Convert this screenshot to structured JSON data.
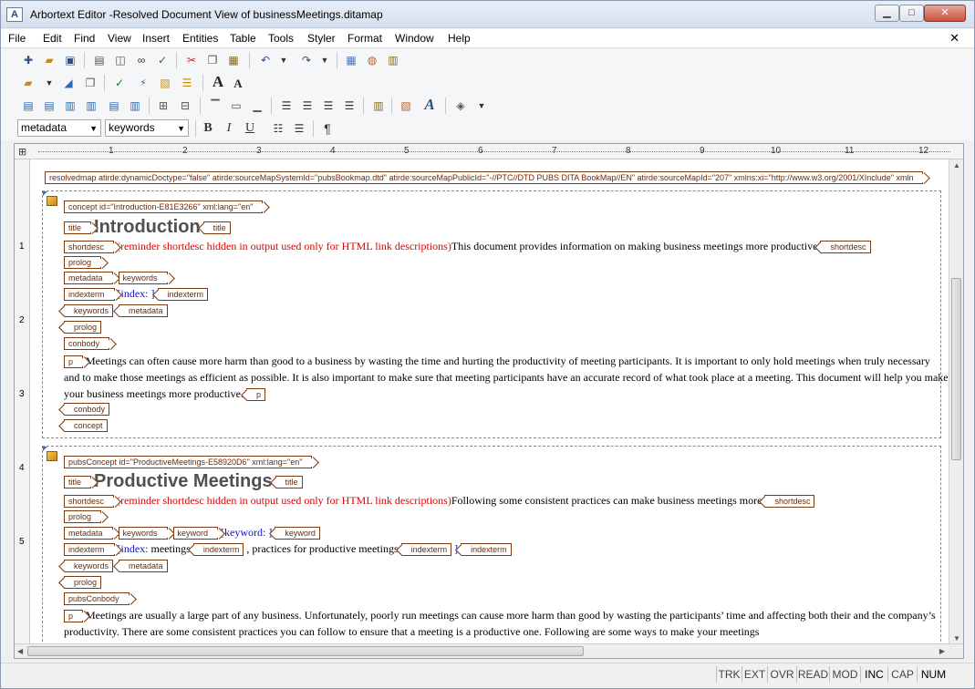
{
  "window": {
    "title": "Arbortext Editor -Resolved Document View of businessMeetings.ditamap",
    "app_icon": "A",
    "controls": {
      "minimize": "▁",
      "maximize": "□",
      "close": "✕"
    }
  },
  "menu": {
    "items": [
      "File",
      "Edit",
      "Find",
      "View",
      "Insert",
      "Entities",
      "Table",
      "Tools",
      "Styler",
      "Format",
      "Window",
      "Help"
    ],
    "close": "✕"
  },
  "toolbar4": {
    "element_select": "metadata",
    "attribute_select": "keywords",
    "bold": "B",
    "italic": "I",
    "underline": "U",
    "pilcrow": "¶"
  },
  "ruler": {
    "corner": "⊞",
    "numbers": [
      "1",
      "2",
      "3",
      "4",
      "5",
      "6",
      "7",
      "8",
      "9",
      "10",
      "11",
      "12"
    ],
    "vertical": [
      "1",
      "2",
      "3",
      "4",
      "5"
    ]
  },
  "document": {
    "root_tag": "resolvedmap atirde:dynamicDoctype=\"false\" atirde:sourceMapSystemId=\"pubsBookmap.dtd\" atirde:sourceMapPublicId=\"-//PTC//DTD PUBS DITA BookMap//EN\" atirde:sourceMapId=\"207\" xmlns:xi=\"http://www.w3.org/2001/XInclude\" xmln",
    "concept1": {
      "tag": "concept id=\"Introduction-E81E3266\" xml:lang=\"en\"",
      "title_tag": "title",
      "title": "Introduction",
      "shortdesc_tag": "shortdesc",
      "shortdesc_reminder": "(reminder shortdesc hidden in output used only for HTML link descriptions)",
      "shortdesc_text": "This document provides information on making business meetings more productive",
      "prolog_tag": "prolog",
      "metadata_tag": "metadata",
      "keywords_tag": "keywords",
      "indexterm_tag": "indexterm",
      "index_text": "[index: ]",
      "conbody_tag": "conbody",
      "p_tag": "p",
      "paragraph": "Meetings can often cause more harm than good to a business by wasting the time and hurting the productivity of meeting participants. It is important to only hold meetings when truly necessary and to make those meetings as efficient as possible. It is also important to make sure that meeting participants have an accurate record of what took place at a meeting. This document will help you make your business meetings more productive.",
      "concept_tag": "concept"
    },
    "concept2": {
      "tag": "pubsConcept id=\"ProductiveMeetings-E58920D6\" xml:lang=\"en\"",
      "title_tag": "title",
      "title": "Productive Meetings",
      "shortdesc_tag": "shortdesc",
      "shortdesc_reminder": "(reminder shortdesc hidden in output used only for HTML link descriptions)",
      "shortdesc_text": "Following some consistent practices can make business meetings more",
      "prolog_tag": "prolog",
      "metadata_tag": "metadata",
      "keywords_tag": "keywords",
      "keyword_tag": "keyword",
      "keyword_text": "[keyword: ]",
      "indexterm_tag": "indexterm",
      "index_prefix": "[index: ",
      "index_meetings": "meetings",
      "index_practices": ",  practices for productive meetings",
      "index_close": "]",
      "conbody_tag": "pubsConbody",
      "p_tag": "p",
      "paragraph": "Meetings are usually a large part of any business. Unfortunately, poorly run meetings can cause more harm than good by wasting the participants’ time and affecting both their and the company’s productivity. There are some consistent practices you can follow to ensure that a meeting is a productive one. Following are some ways to make your meetings"
    }
  },
  "status": [
    "TRK",
    "EXT",
    "OVR",
    "READ",
    "MOD",
    "INC",
    "CAP",
    "NUM"
  ],
  "colors": {
    "tag_border": "#7a3b12",
    "reminder_red": "#e00000",
    "index_blue": "#1010d0",
    "heading_gray": "#505050"
  }
}
